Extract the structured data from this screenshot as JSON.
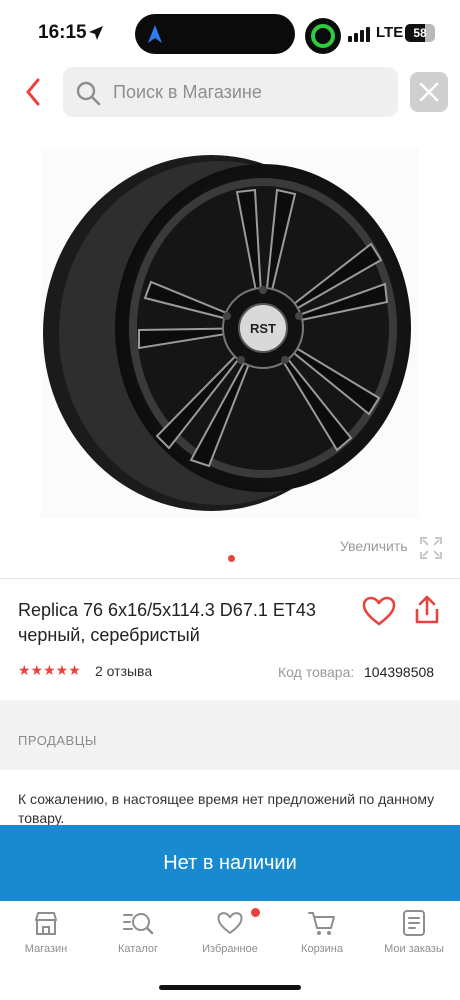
{
  "status_bar": {
    "time": "16:15",
    "network": "LTE",
    "battery": "58"
  },
  "search": {
    "placeholder": "Поиск в Магазине"
  },
  "gallery": {
    "zoom_label": "Увеличить",
    "brand_mark": "RST"
  },
  "product": {
    "title": "Replica 76 6x16/5x114.3 D67.1 ET43 черный, серебристый",
    "rating_stars": "★★★★★",
    "rating": 5,
    "reviews": "2 отзыва",
    "sku_label": "Код товара:",
    "sku": "104398508"
  },
  "sellers": {
    "section_label": "ПРОДАВЦЫ",
    "notice": "К сожалению, в настоящее время нет предложений по данному товару."
  },
  "cta": {
    "label": "Нет в наличии"
  },
  "tabbar": {
    "items": [
      {
        "label": "Магазин",
        "icon": "store-icon"
      },
      {
        "label": "Каталог",
        "icon": "catalog-icon"
      },
      {
        "label": "Избранное",
        "icon": "heart-icon"
      },
      {
        "label": "Корзина",
        "icon": "cart-icon"
      },
      {
        "label": "Мои заказы",
        "icon": "orders-icon"
      }
    ]
  },
  "colors": {
    "accent": "#e8433c",
    "cta": "#1a8ad0"
  }
}
